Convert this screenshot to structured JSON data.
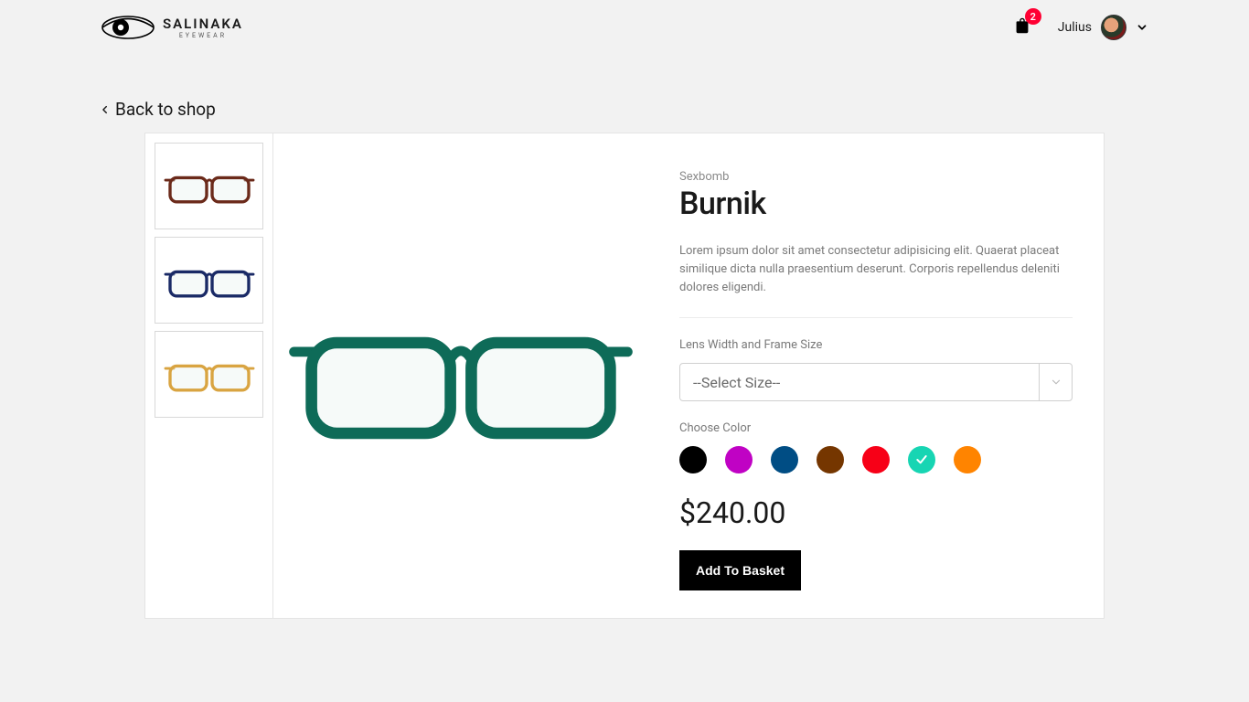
{
  "header": {
    "brand_top": "SALINAKA",
    "brand_sub": "EYEWEAR",
    "cart_count": "2",
    "user_name": "Julius"
  },
  "back_link": "Back to shop",
  "product": {
    "brand": "Sexbomb",
    "name": "Burnik",
    "description": "Lorem ipsum dolor sit amet consectetur adipisicing elit. Quaerat placeat similique dicta nulla praesentium deserunt. Corporis repellendus deleniti dolores eligendi.",
    "size_label": "Lens Width and Frame Size",
    "size_placeholder": "--Select Size--",
    "color_label": "Choose Color",
    "colors": [
      {
        "name": "black",
        "hex": "#000000",
        "selected": false
      },
      {
        "name": "purple",
        "hex": "#c002c4",
        "selected": false
      },
      {
        "name": "blue",
        "hex": "#004d84",
        "selected": false
      },
      {
        "name": "brown",
        "hex": "#753600",
        "selected": false
      },
      {
        "name": "red",
        "hex": "#f70017",
        "selected": false
      },
      {
        "name": "teal",
        "hex": "#17d5b3",
        "selected": true
      },
      {
        "name": "orange",
        "hex": "#ff8400",
        "selected": false
      }
    ],
    "price": "$240.00",
    "add_button": "Add To Basket"
  },
  "thumbnails": [
    {
      "name": "variant-brown-frame",
      "frame_color": "#6b2a1a"
    },
    {
      "name": "variant-navy-frame",
      "frame_color": "#1a2a66"
    },
    {
      "name": "variant-amber-frame",
      "frame_color": "#d9a441"
    }
  ],
  "main_variant": {
    "frame_color": "#0e6b58"
  }
}
